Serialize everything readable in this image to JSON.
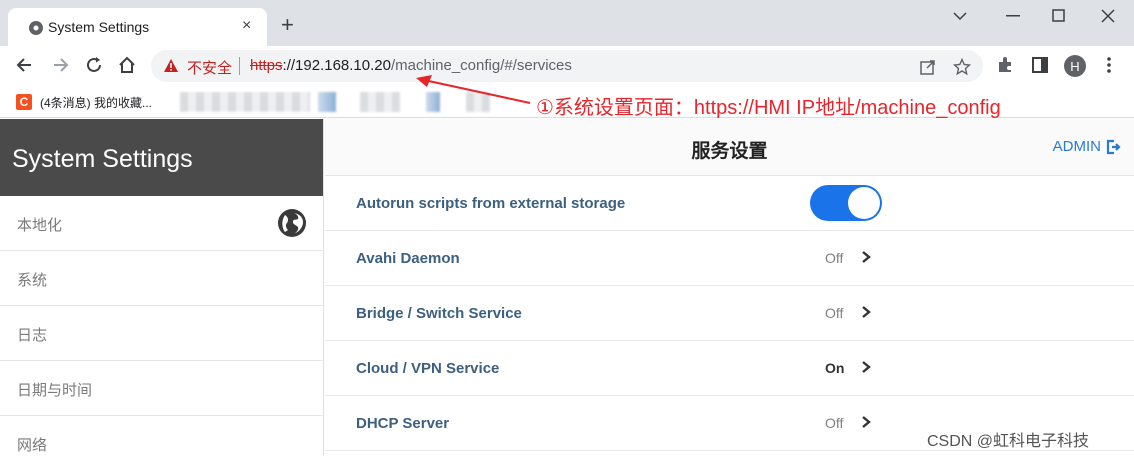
{
  "browser": {
    "tab_title": "System Settings",
    "tab_close": "×",
    "new_tab": "+",
    "not_secure": "不安全",
    "url_scheme": "https",
    "url_host": "://192.168.10.20",
    "url_path": "/machine_config/#/services",
    "profile_initial": "H",
    "bookmark_favicon": "C",
    "bookmark_label": "(4条消息) 我的收藏..."
  },
  "annotation": {
    "text": "①系统设置页面：https://HMI IP地址/machine_config",
    "color": "#e8252b"
  },
  "sidebar": {
    "title": "System Settings",
    "items": [
      {
        "label": "本地化",
        "icon": "globe-icon"
      },
      {
        "label": "系统"
      },
      {
        "label": "日志"
      },
      {
        "label": "日期与时间"
      },
      {
        "label": "网络"
      }
    ]
  },
  "main": {
    "title": "服务设置",
    "admin_label": "ADMIN",
    "services": [
      {
        "label": "Autorun scripts from external storage",
        "control": "toggle",
        "enabled": true
      },
      {
        "label": "Avahi Daemon",
        "status": "Off"
      },
      {
        "label": "Bridge / Switch Service",
        "status": "Off"
      },
      {
        "label": "Cloud / VPN Service",
        "status": "On"
      },
      {
        "label": "DHCP Server",
        "status": "Off"
      }
    ]
  },
  "watermark": "CSDN @虹科电子科技",
  "colors": {
    "sidebar_header_bg": "#4a4a4a",
    "accent_blue": "#1a73e8",
    "service_label": "#3d5f80",
    "admin_link": "#2a7bd0"
  }
}
